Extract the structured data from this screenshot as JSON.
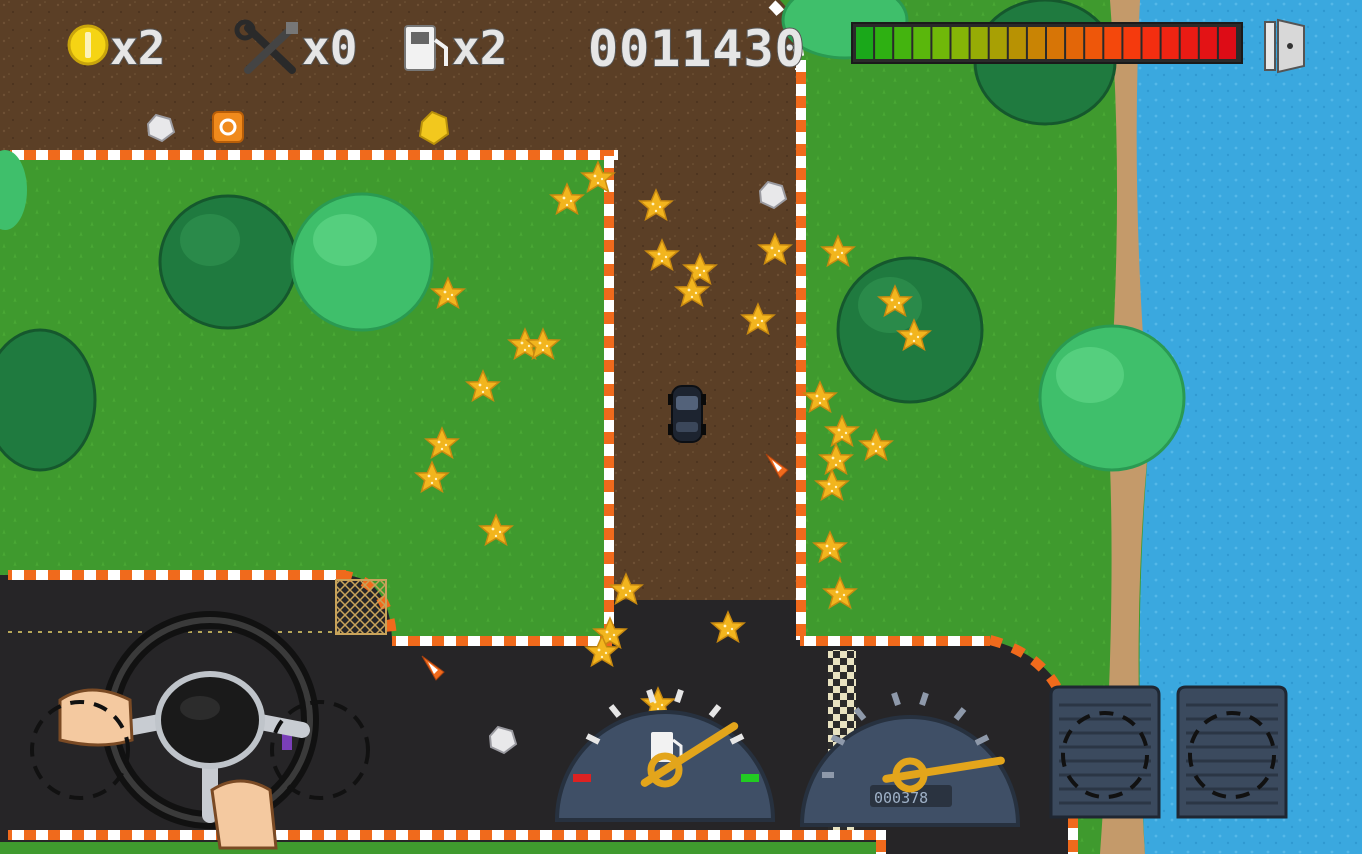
{
  "hud": {
    "coins_count": "x2",
    "repairs_count": "x0",
    "fuel_count": "x2",
    "score": "0011430",
    "health_colors": [
      "#1aa81a",
      "#2eb012",
      "#44b40f",
      "#5ab70c",
      "#70b809",
      "#85b507",
      "#96ac05",
      "#a8a004",
      "#b89203",
      "#c98404",
      "#d77506",
      "#e36608",
      "#ee570a",
      "#f4480c",
      "#f53a0d",
      "#f42e10",
      "#f02412",
      "#ea1b14",
      "#e31315",
      "#dd0c16"
    ]
  },
  "colors": {
    "grass": "#3f9a2e",
    "dirt": "#5b3f26",
    "asphalt": "#262527",
    "water": "#3aa8df",
    "curb_orange": "#f06a1c",
    "curb_white": "#ffffff",
    "star": "#f2b51e",
    "bush_dark": "#1f7a3f",
    "bush_light": "#3fbf6b"
  },
  "icons": {
    "coin": "coin-icon",
    "wrench": "wrench-screwdriver-icon",
    "fuel": "fuel-pump-icon",
    "exit": "exit-door-icon",
    "steering": "steering-wheel",
    "fuel_gauge": "fuel-gauge",
    "speedometer": "speedometer",
    "pedal": "pedal"
  },
  "dashboard": {
    "odometer": "000378",
    "fuel_level": 0.82,
    "speed_level": 0.95
  }
}
